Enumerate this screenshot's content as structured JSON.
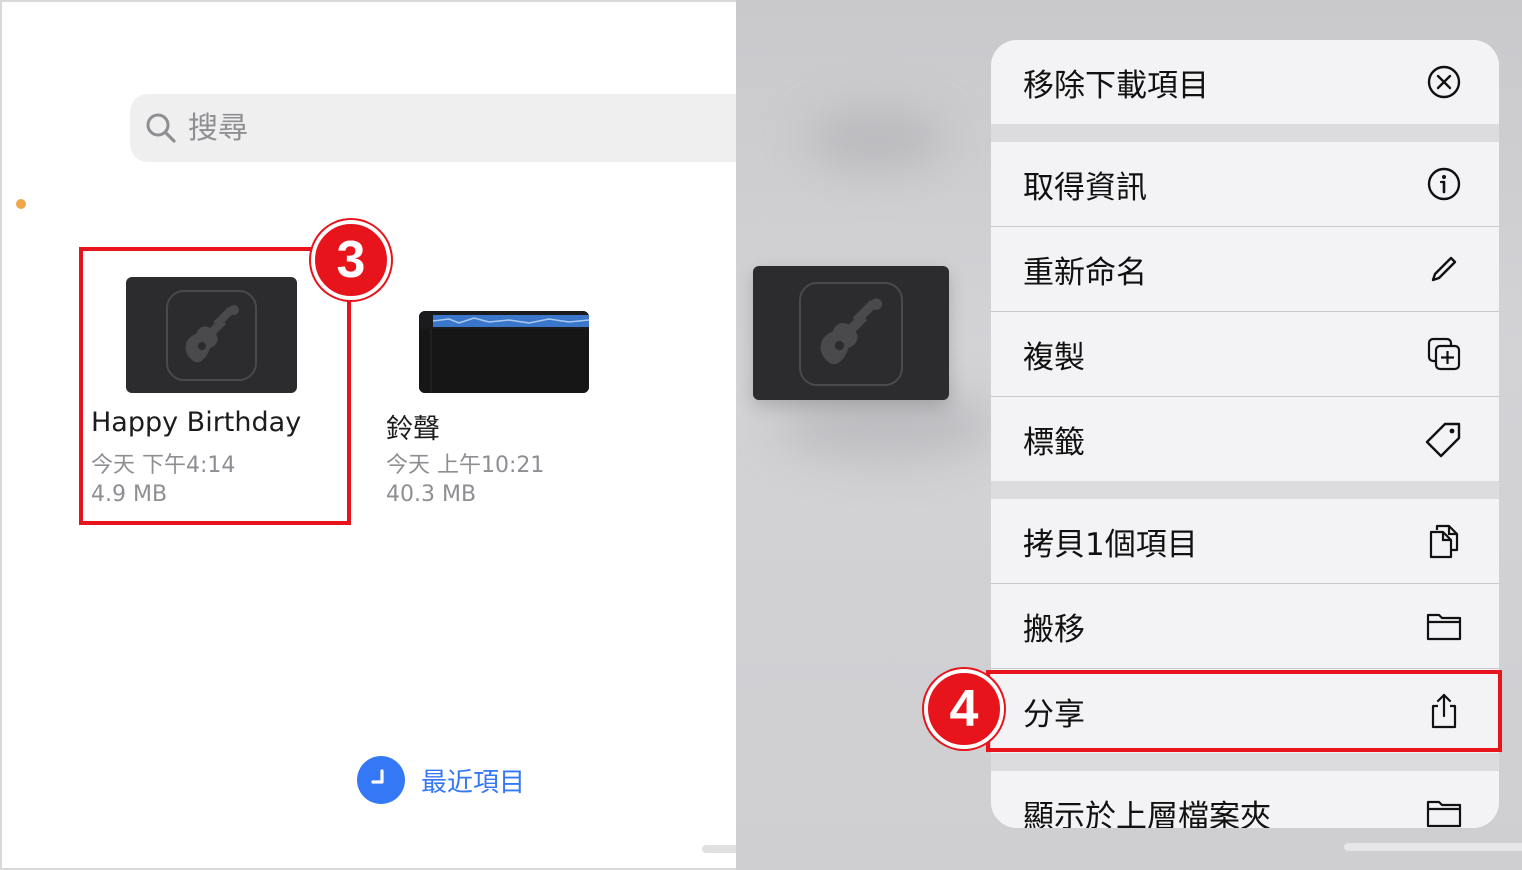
{
  "search": {
    "placeholder": "搜尋"
  },
  "files": [
    {
      "name": "Happy Birthday",
      "date": "今天 下午4:14",
      "size": "4.9 MB"
    },
    {
      "name": "鈴聲",
      "date": "今天 上午10:21",
      "size": "40.3 MB"
    }
  ],
  "steps": {
    "three": "3",
    "four": "4"
  },
  "tab": {
    "recent_label": "最近項目"
  },
  "menu": {
    "items": [
      {
        "label": "移除下載項目",
        "icon": "remove-circle-icon"
      },
      {
        "label": "取得資訊",
        "icon": "info-icon"
      },
      {
        "label": "重新命名",
        "icon": "pencil-icon"
      },
      {
        "label": "複製",
        "icon": "duplicate-icon"
      },
      {
        "label": "標籤",
        "icon": "tag-icon"
      },
      {
        "label": "拷貝1個項目",
        "icon": "copy-icon"
      },
      {
        "label": "搬移",
        "icon": "folder-icon"
      },
      {
        "label": "分享",
        "icon": "share-icon"
      },
      {
        "label": "顯示於上層檔案夾",
        "icon": "folder-icon"
      }
    ]
  },
  "colors": {
    "highlight": "#e8141c",
    "accent": "#3478f6",
    "thumb": "#2c2c2e"
  }
}
